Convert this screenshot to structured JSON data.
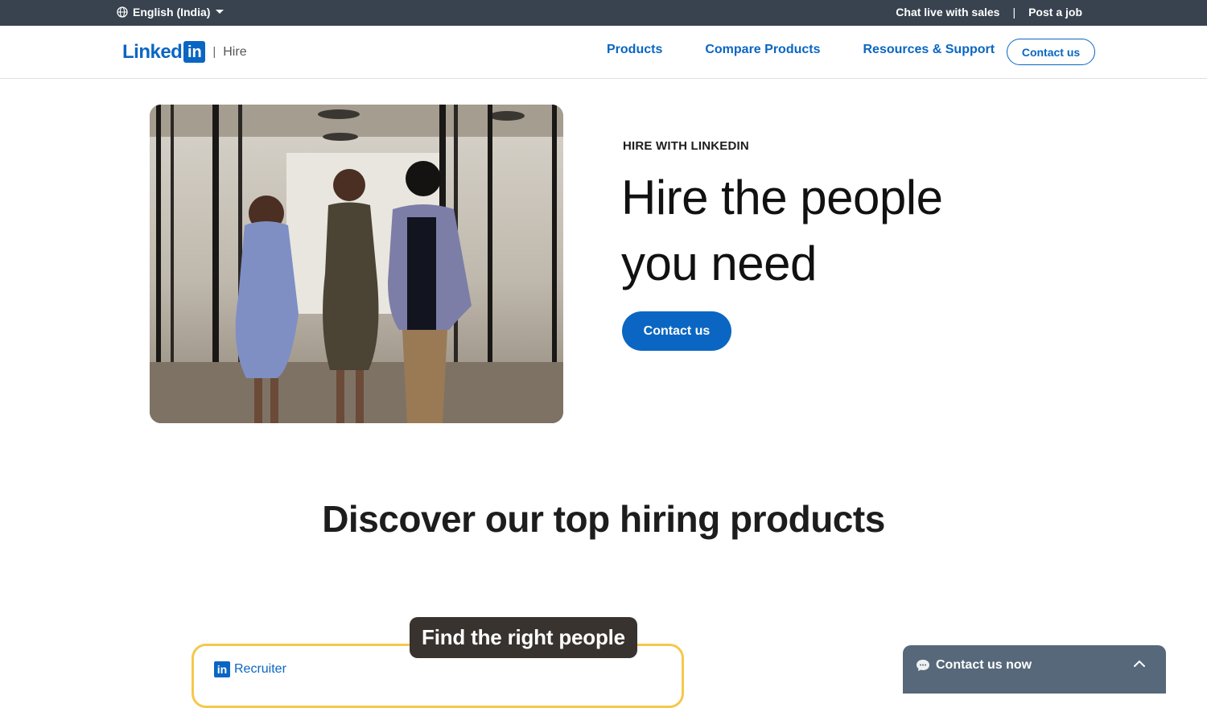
{
  "utility_bar": {
    "language": "English (India)",
    "chat_link": "Chat live with sales",
    "separator": "|",
    "post_job": "Post a job"
  },
  "nav": {
    "logo_text": "Linked",
    "logo_box": "in",
    "divider": "|",
    "subbrand": "Hire",
    "links": [
      "Products",
      "Compare Products",
      "Resources & Support"
    ],
    "cta": "Contact us"
  },
  "hero": {
    "eyebrow": "HIRE WITH LINKEDIN",
    "title_line1": "Hire the people",
    "title_line2": "you need",
    "cta": "Contact us"
  },
  "discover": {
    "heading": "Discover our top hiring products"
  },
  "product_card": {
    "label": "Find the right people",
    "product_logo": "in",
    "product_name": "Recruiter"
  },
  "chat_widget": {
    "label": "Contact us now"
  },
  "colors": {
    "utility_bg": "#38434f",
    "brand_blue": "#0a66c2",
    "chat_bg": "#56687a",
    "card_border": "#f5c84c",
    "card_label_bg": "#38332f"
  }
}
